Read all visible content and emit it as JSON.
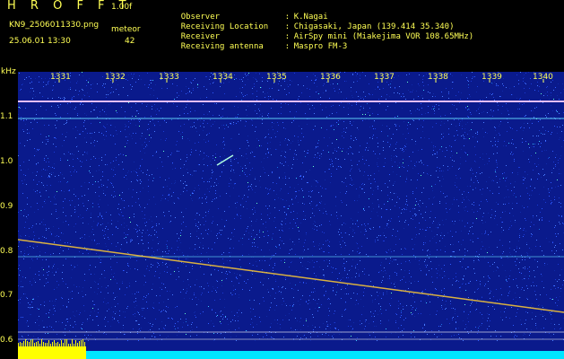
{
  "header": {
    "title": "H R O F F T",
    "version": "1.00f",
    "filename": "KN9_2506011330.png",
    "meteor_label": "meteor",
    "datetime": "25.06.01 13:30",
    "meteor_count": "42"
  },
  "info": [
    {
      "key": "Observer",
      "value": "K.Nagai"
    },
    {
      "key": "Receiving Location",
      "value": "Chigasaki, Japan (139.414 35.340)"
    },
    {
      "key": "Receiver",
      "value": "AirSpy mini (Miakejima VOR 108.65MHz)"
    },
    {
      "key": "Receiving antenna",
      "value": "Maspro FM-3"
    }
  ],
  "axis": {
    "unit_label": "kHz",
    "y_ticks": [
      "1.1",
      "1.0",
      "0.9",
      "0.8",
      "0.7",
      "0.6"
    ],
    "x_ticks": [
      "1331",
      "1332",
      "1333",
      "1334",
      "1335",
      "1336",
      "1337",
      "1338",
      "1339",
      "1340"
    ]
  },
  "colors": {
    "background": "#0a1a8c",
    "text": "#ffff55",
    "signal_line": "#e0e0ff",
    "meteor_trail": "#ffcc33",
    "bottom_bar": "#00e5ff"
  }
}
